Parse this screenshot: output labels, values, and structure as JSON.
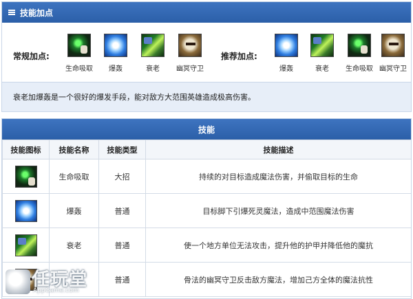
{
  "panel1": {
    "title": "技能加点",
    "normal_label": "常规加点:",
    "recommended_label": "推荐加点:",
    "normal_skills": [
      {
        "name": "生命吸取",
        "icon": "life-drain-icon"
      },
      {
        "name": "爆轰",
        "icon": "blast-icon"
      },
      {
        "name": "衰老",
        "icon": "decrepify-icon"
      },
      {
        "name": "幽冥守卫",
        "icon": "nether-ward-icon"
      }
    ],
    "recommended_skills": [
      {
        "name": "爆轰",
        "icon": "blast-icon"
      },
      {
        "name": "衰老",
        "icon": "decrepify-icon"
      },
      {
        "name": "生命吸取",
        "icon": "life-drain-icon"
      },
      {
        "name": "幽冥守卫",
        "icon": "nether-ward-icon"
      }
    ],
    "description": "衰老加爆轰是一个很好的爆发手段，能对敌方大范围英雄造成极高伤害。"
  },
  "panel2": {
    "title": "技能",
    "headers": [
      "技能图标",
      "技能名称",
      "技能类型",
      "技能描述"
    ],
    "rows": [
      {
        "icon": "life-drain-icon",
        "name": "生命吸取",
        "type": "大招",
        "desc": "持续的对目标造成魔法伤害，并偷取目标的生命"
      },
      {
        "icon": "blast-icon",
        "name": "爆轰",
        "type": "普通",
        "desc": "目标脚下引爆死灵魔法，造成中范围魔法伤害"
      },
      {
        "icon": "decrepify-icon",
        "name": "衰老",
        "type": "普通",
        "desc": "使一个地方单位无法攻击，提升他的护甲并降低他的魔抗"
      },
      {
        "icon": "nether-ward-icon",
        "name": "",
        "type": "普通",
        "desc": "骨法的幽冥守卫反击敌方魔法，增加己方全体的魔法抗性"
      }
    ]
  },
  "watermark": {
    "text": "任玩堂",
    "sub": "AppGame.com"
  },
  "colors": {
    "header_blue": "#2f65b0",
    "desc_bg": "#e7eef8",
    "border": "#c9d6e8"
  }
}
